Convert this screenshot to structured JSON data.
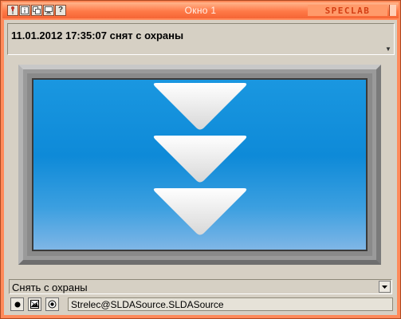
{
  "window": {
    "title": "Окно 1",
    "logo_text": "SPECLAB",
    "accent_color": "#ff7a48"
  },
  "titlebar_buttons": [
    {
      "name": "pin-icon"
    },
    {
      "name": "info-icon"
    },
    {
      "name": "copy-window-icon"
    },
    {
      "name": "monitor-icon"
    },
    {
      "name": "help-icon",
      "label": "?"
    }
  ],
  "event": {
    "text": "11.01.2012 17:35:07 снят с охраны"
  },
  "panel": {
    "screen_color": "#0e8ad8",
    "indicator": "triple-down-arrow-icon"
  },
  "command": {
    "selected": "Снять с охраны"
  },
  "toolbar": {
    "buttons": [
      {
        "name": "record-icon"
      },
      {
        "name": "image-icon"
      },
      {
        "name": "target-icon"
      }
    ],
    "source": "Strelec@SLDASource.SLDASource"
  }
}
